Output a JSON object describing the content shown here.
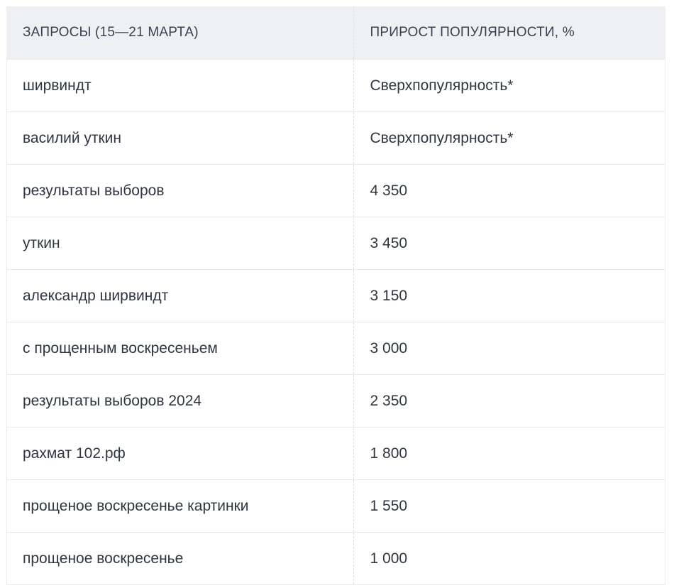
{
  "table": {
    "headers": [
      "ЗАПРОСЫ (15—21 МАРТА)",
      "ПРИРОСТ ПОПУЛЯРНОСТИ, %"
    ],
    "rows": [
      [
        "ширвиндт",
        "Сверхпопулярность*"
      ],
      [
        "василий уткин",
        "Сверхпопулярность*"
      ],
      [
        "результаты выборов",
        "4 350"
      ],
      [
        "уткин",
        "3 450"
      ],
      [
        "александр ширвиндт",
        "3 150"
      ],
      [
        "с прощенным воскресеньем",
        "3 000"
      ],
      [
        "результаты выборов 2024",
        "2 350"
      ],
      [
        "рахмат 102.рф",
        "1 800"
      ],
      [
        "прощеное воскресенье картинки",
        "1 550"
      ],
      [
        "прощеное воскресенье",
        "1 000"
      ]
    ]
  }
}
